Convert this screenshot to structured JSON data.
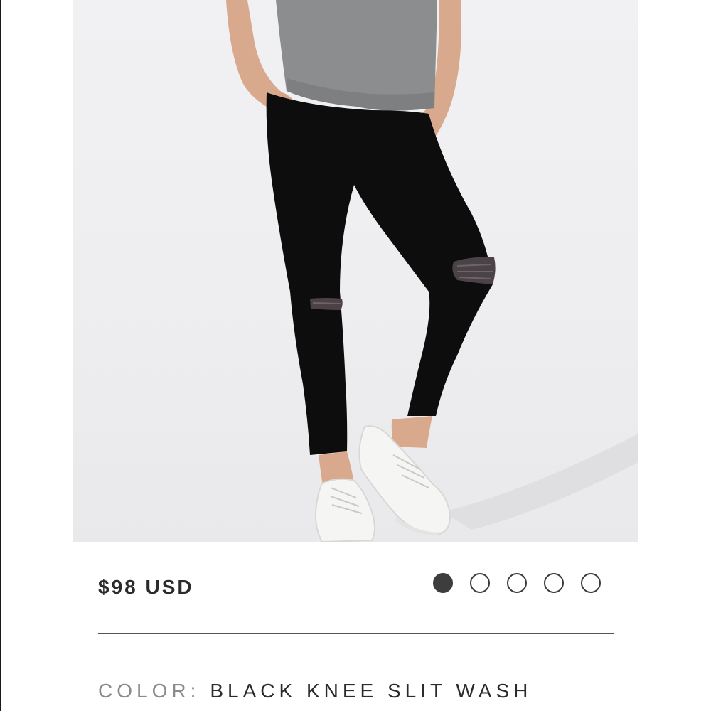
{
  "product": {
    "price": "$98 USD",
    "color_label": "COLOR:",
    "color_value": "BLACK KNEE SLIT WASH"
  },
  "carousel": {
    "total": 5,
    "active_index": 0
  },
  "colors": {
    "dot_active": "#3d3d3d",
    "dot_border": "#3a3a3a",
    "price_text": "#2b2b2b",
    "label_text": "#8a8a8a",
    "divider": "#555555",
    "jeans": "#0d0d0d",
    "tshirt": "#8c8d8f",
    "sneakers": "#f5f5f3"
  }
}
